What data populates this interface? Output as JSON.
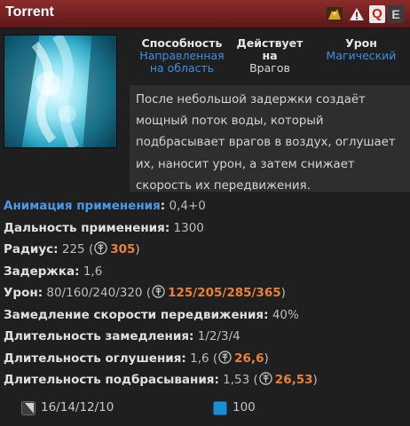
{
  "title": "Torrent",
  "hotkeys": {
    "q": "Q",
    "e": "E"
  },
  "header": {
    "ability_label": "Способность",
    "ability_value_1": "Направленная",
    "ability_value_2": "на область",
    "affects_label": "Действует на",
    "affects_value": "Врагов",
    "damage_label": "Урон",
    "damage_value": "Магический"
  },
  "description": "После небольшой задержки создаёт мощный поток воды, который подбрасывает врагов в воздух, оглушает их, наносит урон, а затем снижает скорость их передвижения.",
  "stats": {
    "cast_anim_label": "Анимация применения",
    "cast_anim_value": "0,4+0",
    "cast_range_label": "Дальность применения",
    "cast_range_value": "1300",
    "radius_label": "Радиус",
    "radius_value": "225",
    "radius_scepter": "305",
    "delay_label": "Задержка",
    "delay_value": "1,6",
    "damage_label": "Урон",
    "damage_value": "80/160/240/320",
    "damage_scepter": "125/205/285/365",
    "slow_label": "Замедление скорости передвижения",
    "slow_value": "40%",
    "slow_duration_label": "Длительность замедления",
    "slow_duration_value": "1/2/3/4",
    "stun_duration_label": "Длительность оглушения",
    "stun_duration_value": "1,6",
    "stun_scepter": "26,6",
    "knockup_duration_label": "Длительность подбрасывания",
    "knockup_duration_value": "1,53",
    "knockup_scepter": "26,53"
  },
  "footer": {
    "cooldown": "16/14/12/10",
    "mana": "100"
  },
  "colors": {
    "title_bar": "#7a2424",
    "accent_blue": "#3f8fe0",
    "scepter_orange": "#e8813a",
    "mana_blue": "#1a8fd6"
  }
}
